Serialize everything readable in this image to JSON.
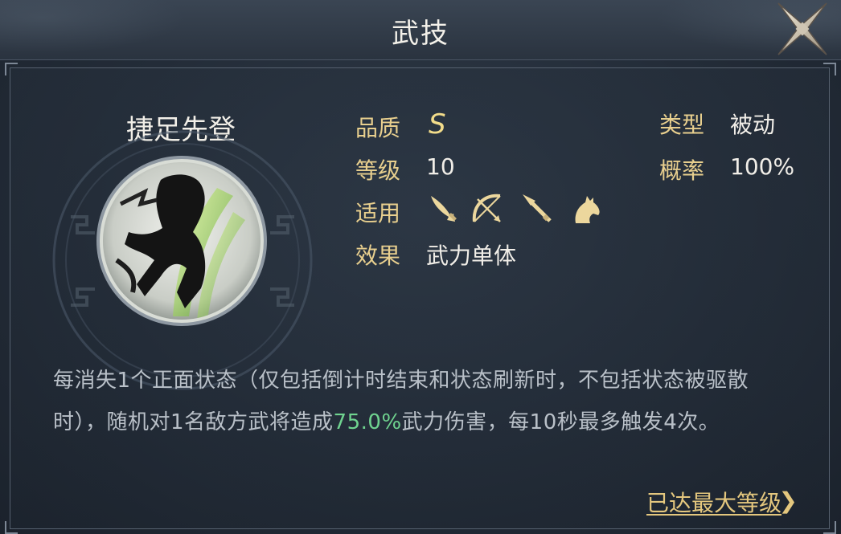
{
  "header": {
    "title": "武技"
  },
  "skill": {
    "name": "捷足先登",
    "quality_label": "品质",
    "quality_value": "S",
    "level_label": "等级",
    "level_value": "10",
    "applicable_label": "适用",
    "applicable_icons": [
      "sword-icon",
      "bow-icon",
      "spear-icon",
      "horse-icon"
    ],
    "effect_label": "效果",
    "effect_value": "武力单体",
    "type_label": "类型",
    "type_value": "被动",
    "chance_label": "概率",
    "chance_value": "100%"
  },
  "description": {
    "part1": "每消失1个正面状态（仅包括倒计时结束和状态刷新时，不包括状态被驱散时），随机对1名敌方武将造成",
    "highlight": "75.0%",
    "part2": "武力伤害，每10秒最多触发4次。"
  },
  "footer": {
    "max_level_label": "已达最大等级",
    "chevron": "❯"
  },
  "colors": {
    "label_gold": "#e8cf8e",
    "highlight_green": "#6fd38f",
    "grade_gold": "#f2dc8a"
  }
}
